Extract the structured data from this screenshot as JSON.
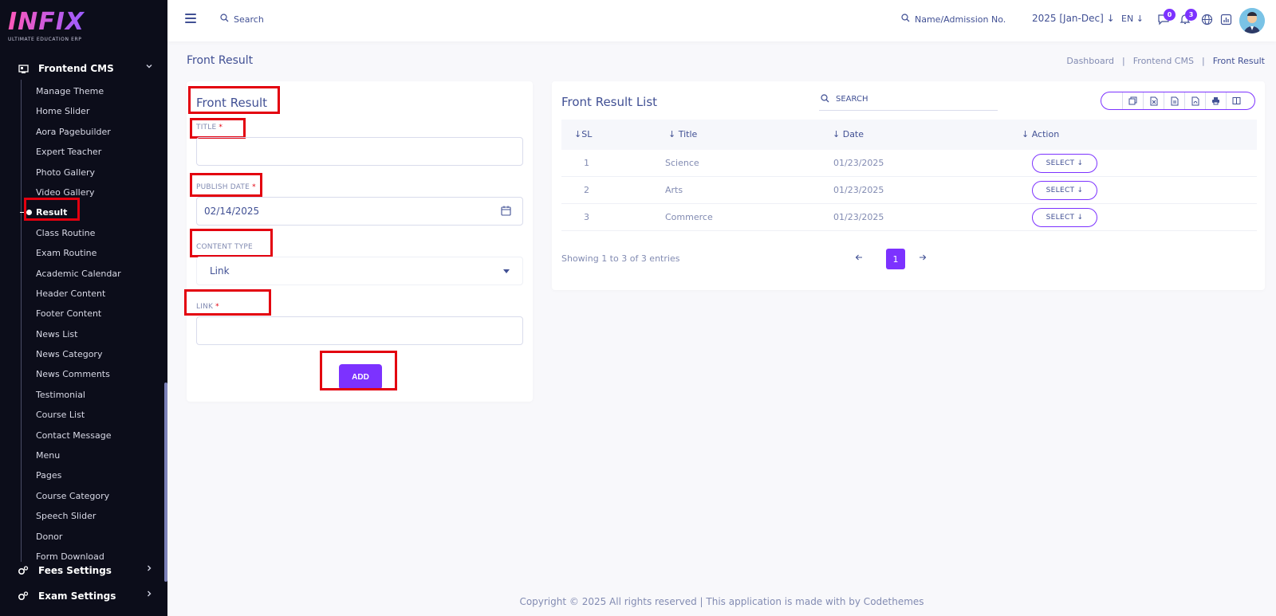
{
  "sidebar": {
    "logo_text": "INFIX",
    "logo_subtitle": "ULTIMATE EDUCATION ERP",
    "group_frontend": "Frontend CMS",
    "group_fees": "Fees Settings",
    "group_exam": "Exam Settings",
    "items": [
      "Manage Theme",
      "Home Slider",
      "Aora Pagebuilder",
      "Expert Teacher",
      "Photo Gallery",
      "Video Gallery",
      "Result",
      "Class Routine",
      "Exam Routine",
      "Academic Calendar",
      "Header Content",
      "Footer Content",
      "News List",
      "News Category",
      "News Comments",
      "Testimonial",
      "Course List",
      "Contact Message",
      "Menu",
      "Pages",
      "Course Category",
      "Speech Slider",
      "Donor",
      "Form Download"
    ]
  },
  "header": {
    "search_label": "Search",
    "admission_search": "Name/Admission No.",
    "year": "2025 [Jan-Dec]",
    "lang": "EN",
    "messages_badge": "0",
    "notifications_badge": "3"
  },
  "page": {
    "title": "Front Result",
    "breadcrumb": [
      "Dashboard",
      "Frontend CMS",
      "Front Result"
    ]
  },
  "form": {
    "title": "Front Result",
    "title_label": "TITLE",
    "publish_date_label": "PUBLISH DATE",
    "publish_date_value": "02/14/2025",
    "content_type_label": "CONTENT TYPE",
    "content_type_value": "Link",
    "link_label": "LINK",
    "required_mark": "*",
    "add_button": "ADD"
  },
  "list": {
    "title": "Front Result List",
    "search_label": "SEARCH",
    "columns": [
      "SL",
      "Title",
      "Date",
      "Action"
    ],
    "rows": [
      {
        "sl": "1",
        "title": "Science",
        "date": "01/23/2025",
        "action": "SELECT"
      },
      {
        "sl": "2",
        "title": "Arts",
        "date": "01/23/2025",
        "action": "SELECT"
      },
      {
        "sl": "3",
        "title": "Commerce",
        "date": "01/23/2025",
        "action": "SELECT"
      }
    ],
    "entries_text": "Showing 1 to 3 of 3 entries",
    "current_page": "1"
  },
  "footer": {
    "text": "Copyright © 2025 All rights reserved | This application is made with by Codethemes"
  },
  "colors": {
    "accent": "#7c32ff",
    "sidebar_bg": "#0c0d1a",
    "text_primary": "#415094",
    "highlight": "#e3000f"
  }
}
